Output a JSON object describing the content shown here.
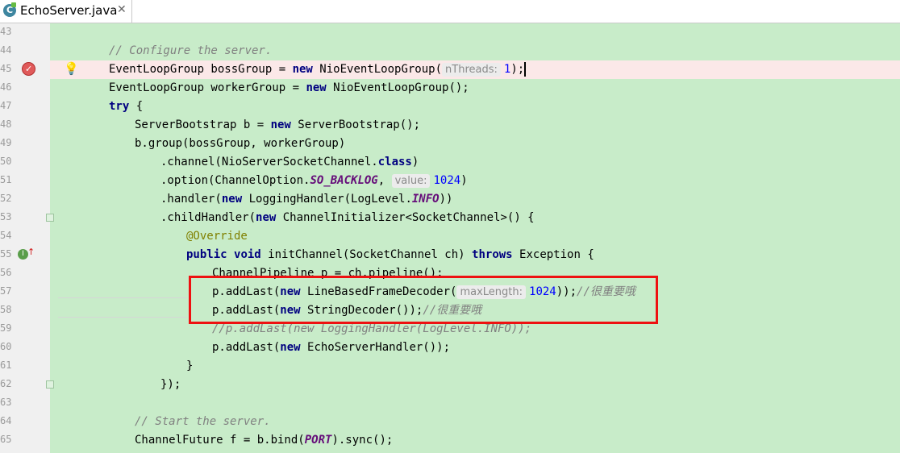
{
  "tab": {
    "icon_letter": "C",
    "title": "EchoServer.java",
    "close_glyph": "✕"
  },
  "lines": [
    {
      "num": "43",
      "indent": 0,
      "tokens": []
    },
    {
      "num": "44",
      "indent": 1,
      "tokens": [
        {
          "t": "// Configure the server.",
          "c": "cm"
        }
      ]
    },
    {
      "num": "45",
      "indent": 1,
      "current": true,
      "tokens": [
        {
          "t": "EventLoopGroup bossGroup = "
        },
        {
          "t": "new",
          "c": "kw"
        },
        {
          "t": " NioEventLoopGroup("
        },
        {
          "t": "nThreads:",
          "c": "hint"
        },
        {
          "t": "1",
          "c": "num"
        },
        {
          "t": ");"
        },
        {
          "t": "",
          "c": "caret"
        }
      ]
    },
    {
      "num": "46",
      "indent": 1,
      "tokens": [
        {
          "t": "EventLoopGroup workerGroup = "
        },
        {
          "t": "new",
          "c": "kw"
        },
        {
          "t": " NioEventLoopGroup();"
        }
      ]
    },
    {
      "num": "47",
      "indent": 1,
      "tokens": [
        {
          "t": "try",
          "c": "kw"
        },
        {
          "t": " {"
        }
      ]
    },
    {
      "num": "48",
      "indent": 2,
      "tokens": [
        {
          "t": "ServerBootstrap b = "
        },
        {
          "t": "new",
          "c": "kw"
        },
        {
          "t": " ServerBootstrap();"
        }
      ]
    },
    {
      "num": "49",
      "indent": 2,
      "tokens": [
        {
          "t": "b.group(bossGroup, workerGroup)"
        }
      ]
    },
    {
      "num": "50",
      "indent": 3,
      "tokens": [
        {
          "t": ".channel(NioServerSocketChannel."
        },
        {
          "t": "class",
          "c": "kw"
        },
        {
          "t": ")"
        }
      ]
    },
    {
      "num": "51",
      "indent": 3,
      "tokens": [
        {
          "t": ".option(ChannelOption."
        },
        {
          "t": "SO_BACKLOG",
          "c": "fld"
        },
        {
          "t": ", "
        },
        {
          "t": "value:",
          "c": "hint"
        },
        {
          "t": "1024",
          "c": "num"
        },
        {
          "t": ")"
        }
      ]
    },
    {
      "num": "52",
      "indent": 3,
      "tokens": [
        {
          "t": ".handler("
        },
        {
          "t": "new",
          "c": "kw"
        },
        {
          "t": " LoggingHandler(LogLevel."
        },
        {
          "t": "INFO",
          "c": "fld"
        },
        {
          "t": "))"
        }
      ]
    },
    {
      "num": "53",
      "indent": 3,
      "tokens": [
        {
          "t": ".childHandler("
        },
        {
          "t": "new",
          "c": "kw"
        },
        {
          "t": " ChannelInitializer<SocketChannel>() {"
        }
      ]
    },
    {
      "num": "54",
      "indent": 4,
      "tokens": [
        {
          "t": "@Override",
          "c": "ann"
        }
      ]
    },
    {
      "num": "55",
      "indent": 4,
      "tokens": [
        {
          "t": "public",
          "c": "kw"
        },
        {
          "t": " "
        },
        {
          "t": "void",
          "c": "kw"
        },
        {
          "t": " initChannel(SocketChannel ch) "
        },
        {
          "t": "throws",
          "c": "kw"
        },
        {
          "t": " Exception {"
        }
      ]
    },
    {
      "num": "56",
      "indent": 5,
      "tokens": [
        {
          "t": "ChannelPipeline p = ch.pipeline();"
        }
      ]
    },
    {
      "num": "57",
      "indent": 5,
      "tokens": [
        {
          "t": "p.addLast("
        },
        {
          "t": "new",
          "c": "kw"
        },
        {
          "t": " LineBasedFrameDecoder("
        },
        {
          "t": "maxLength:",
          "c": "hint"
        },
        {
          "t": "1024",
          "c": "num"
        },
        {
          "t": "));"
        },
        {
          "t": "//很重要哦",
          "c": "cm"
        }
      ]
    },
    {
      "num": "58",
      "indent": 5,
      "tokens": [
        {
          "t": "p.addLast("
        },
        {
          "t": "new",
          "c": "kw"
        },
        {
          "t": " StringDecoder());"
        },
        {
          "t": "//很重要哦",
          "c": "cm"
        }
      ]
    },
    {
      "num": "59",
      "indent": 5,
      "tokens": [
        {
          "t": "//p.addLast(new LoggingHandler(LogLevel.INFO));",
          "c": "cm"
        }
      ]
    },
    {
      "num": "60",
      "indent": 5,
      "tokens": [
        {
          "t": "p.addLast("
        },
        {
          "t": "new",
          "c": "kw"
        },
        {
          "t": " EchoServerHandler());"
        }
      ]
    },
    {
      "num": "61",
      "indent": 4,
      "tokens": [
        {
          "t": "}"
        }
      ]
    },
    {
      "num": "62",
      "indent": 3,
      "tokens": [
        {
          "t": "});"
        }
      ]
    },
    {
      "num": "63",
      "indent": 0,
      "tokens": []
    },
    {
      "num": "64",
      "indent": 2,
      "tokens": [
        {
          "t": "// Start the server.",
          "c": "cm"
        }
      ]
    },
    {
      "num": "65",
      "indent": 2,
      "tokens": [
        {
          "t": "ChannelFuture f = b.bind("
        },
        {
          "t": "PORT",
          "c": "fld"
        },
        {
          "t": ").sync();"
        }
      ]
    }
  ],
  "colors": {
    "editor_bg": "#c8ecc9",
    "current_line_bg": "#fbe8e8",
    "highlight_box": "#ee1111",
    "keyword": "#000080",
    "comment": "#808080",
    "number": "#0000ff"
  },
  "icons": {
    "tab_file": "java-class-icon",
    "breakpoint": "breakpoint-icon",
    "intention": "lightbulb-icon",
    "override": "override-method-icon"
  }
}
